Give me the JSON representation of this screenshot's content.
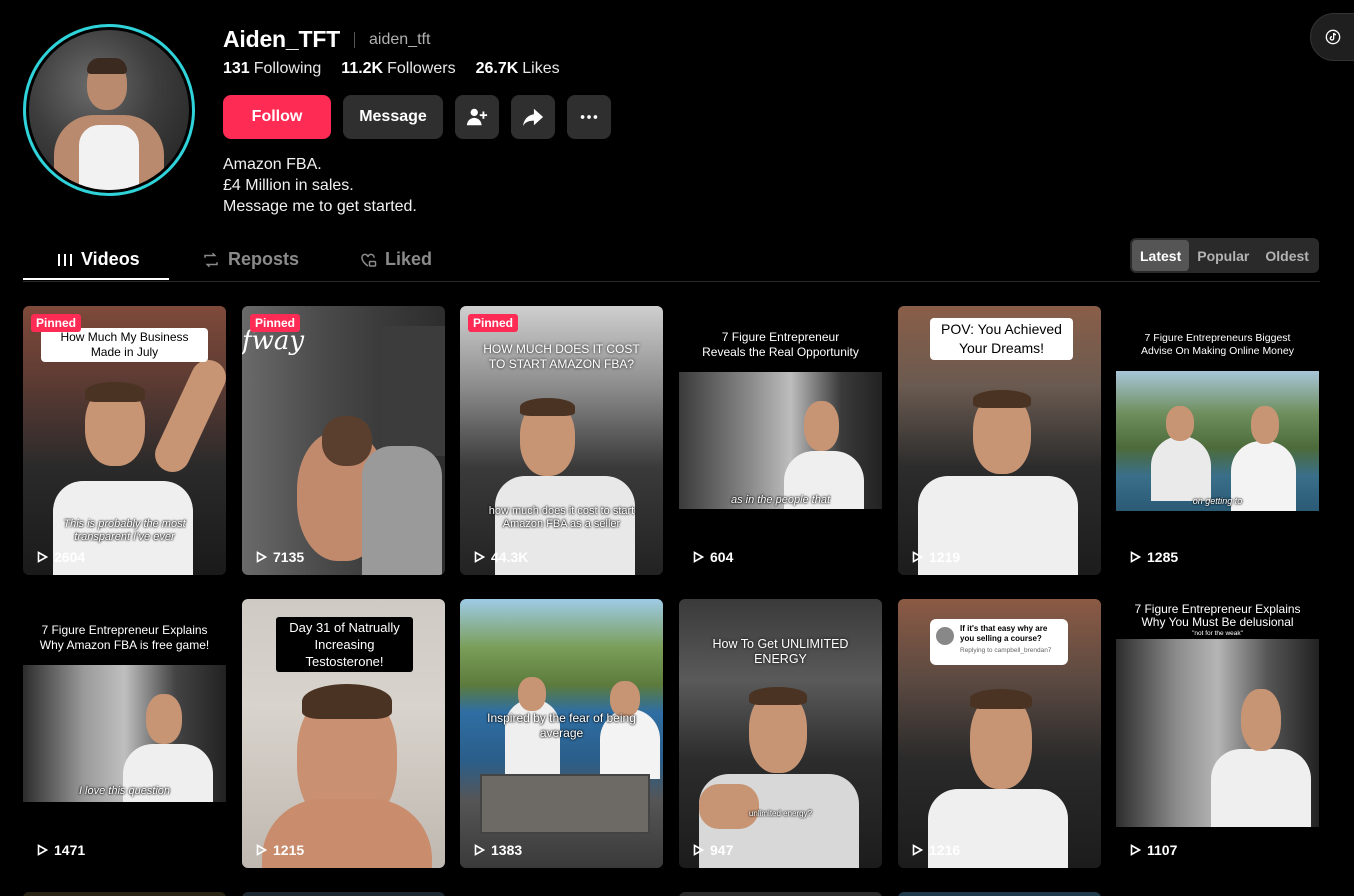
{
  "profile": {
    "display_name": "Aiden_TFT",
    "handle": "aiden_tft",
    "following_count": "131",
    "following_label": "Following",
    "followers_count": "11.2K",
    "followers_label": "Followers",
    "likes_count": "26.7K",
    "likes_label": "Likes",
    "bio": [
      "Amazon FBA.",
      "£4 Million in sales.",
      "Message me to get started."
    ]
  },
  "actions": {
    "follow_label": "Follow",
    "message_label": "Message",
    "add_friend_icon": "add-user-icon",
    "share_icon": "share-arrow-icon",
    "more_icon": "more-dots-icon"
  },
  "tabs": [
    {
      "label": "Videos",
      "icon": "grid-icon",
      "active": true
    },
    {
      "label": "Reposts",
      "icon": "repost-icon",
      "active": false
    },
    {
      "label": "Liked",
      "icon": "heart-lock-icon",
      "active": false
    }
  ],
  "sort": [
    {
      "label": "Latest",
      "active": true
    },
    {
      "label": "Popular",
      "active": false
    },
    {
      "label": "Oldest",
      "active": false
    }
  ],
  "pinned_label": "Pinned",
  "colors": {
    "accent": "#fe2c55",
    "avatar_ring": "#2fd3d9",
    "background": "#000000"
  },
  "videos": [
    {
      "views": "2604",
      "pinned": true,
      "caption": "How Much My Business Made in July",
      "subtitle": "This is probably the most transparent I’ve ever"
    },
    {
      "views": "7135",
      "pinned": true,
      "caption": "",
      "subtitle": "",
      "watermark": "fway"
    },
    {
      "views": "44.3K",
      "pinned": true,
      "caption": "HOW MUCH DOES IT COST TO START AMAZON FBA?",
      "subtitle": "how much does it cost to start Amazon FBA as a seller"
    },
    {
      "views": "604",
      "pinned": false,
      "caption": "7 Figure Entrepreneur Reveals the Real Opportunity",
      "subtitle": "as in the people that"
    },
    {
      "views": "1219",
      "pinned": false,
      "caption": "POV: You Achieved Your Dreams!",
      "subtitle": ""
    },
    {
      "views": "1285",
      "pinned": false,
      "caption": "7 Figure Entrepreneurs Biggest Advise On Making Online Money",
      "subtitle": "on getting to"
    },
    {
      "views": "1471",
      "pinned": false,
      "caption": "7 Figure Entrepreneur Explains Why Amazon FBA is free game!",
      "subtitle": "I love this question"
    },
    {
      "views": "1215",
      "pinned": false,
      "caption": "Day 31 of Natrually Increasing Testosterone!",
      "subtitle": ""
    },
    {
      "views": "1383",
      "pinned": false,
      "caption": "Inspired by the fear of being average",
      "subtitle": ""
    },
    {
      "views": "947",
      "pinned": false,
      "caption": "How To Get UNLIMITED ENERGY",
      "subtitle": "unlimited energy?"
    },
    {
      "views": "1216",
      "pinned": false,
      "caption": "",
      "subtitle": "",
      "reply_bubble": {
        "title": "If it's that easy why are you selling a course?",
        "sub": "Replying to campbell_brendan7"
      }
    },
    {
      "views": "1107",
      "pinned": false,
      "caption": "7 Figure Entrepreneur Explains Why You Must Be delusional",
      "subtitle": "\"not for the weak\""
    }
  ]
}
